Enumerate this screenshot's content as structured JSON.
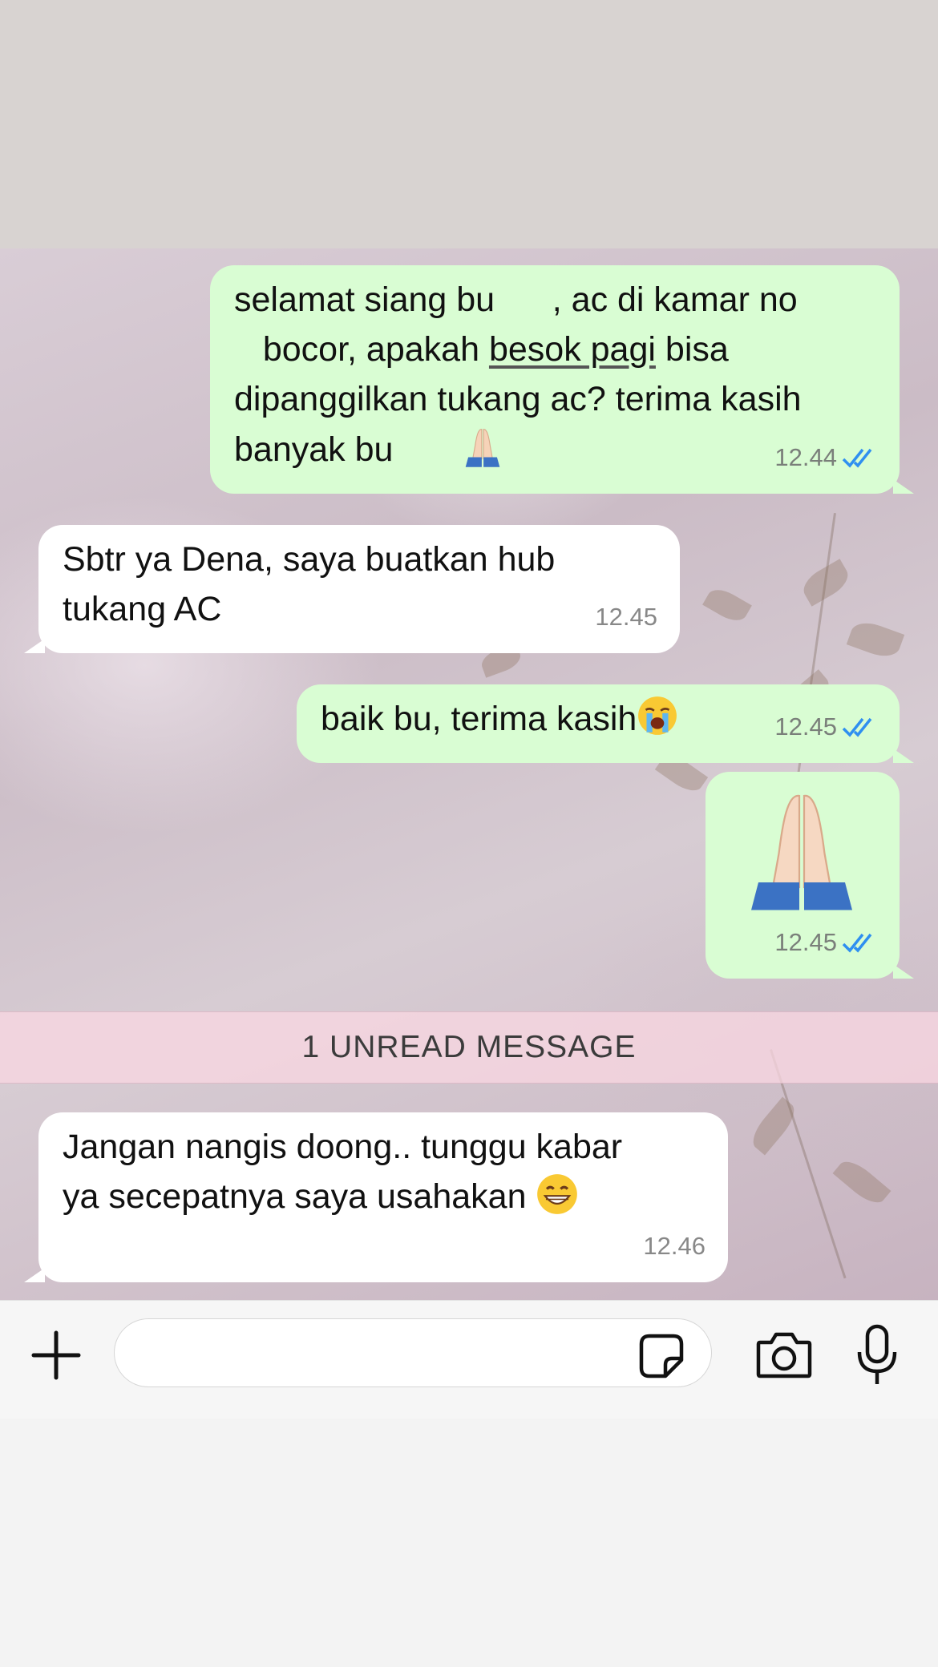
{
  "messages": [
    {
      "direction": "outgoing",
      "lines": [
        "selamat siang bu      , ac di kamar no",
        "   bocor, apakah ",
        "dipanggilkan tukang ac? terima kasih",
        "banyak bu"
      ],
      "link_text": "besok pagi",
      "line2_suffix": " bisa",
      "trailing_emoji": "folded-hands",
      "time": "12.44",
      "status": "read"
    },
    {
      "direction": "incoming",
      "text": "Sbtr ya Dena, saya buatkan hub\ntukang AC",
      "time": "12.45"
    },
    {
      "direction": "outgoing",
      "text": "baik bu, terima kasih",
      "trailing_emoji": "loudly-crying-face",
      "time": "12.45",
      "status": "read"
    },
    {
      "direction": "outgoing",
      "emoji_only": "folded-hands",
      "time": "12.45",
      "status": "read"
    },
    {
      "direction": "incoming",
      "text": "Jangan nangis doong.. tunggu kabar\nya secepatnya saya usahakan",
      "trailing_emoji": "grinning-face",
      "time": "12.46"
    }
  ],
  "unread_divider": "1 UNREAD MESSAGE",
  "composer": {
    "placeholder": "",
    "icons": [
      "plus-icon",
      "sticker-icon",
      "camera-icon",
      "microphone-icon"
    ]
  },
  "colors": {
    "outgoing_bubble": "#d9fdd3",
    "incoming_bubble": "#ffffff",
    "read_ticks": "#2f8ff0",
    "unread_bar": "#f8d6df"
  }
}
